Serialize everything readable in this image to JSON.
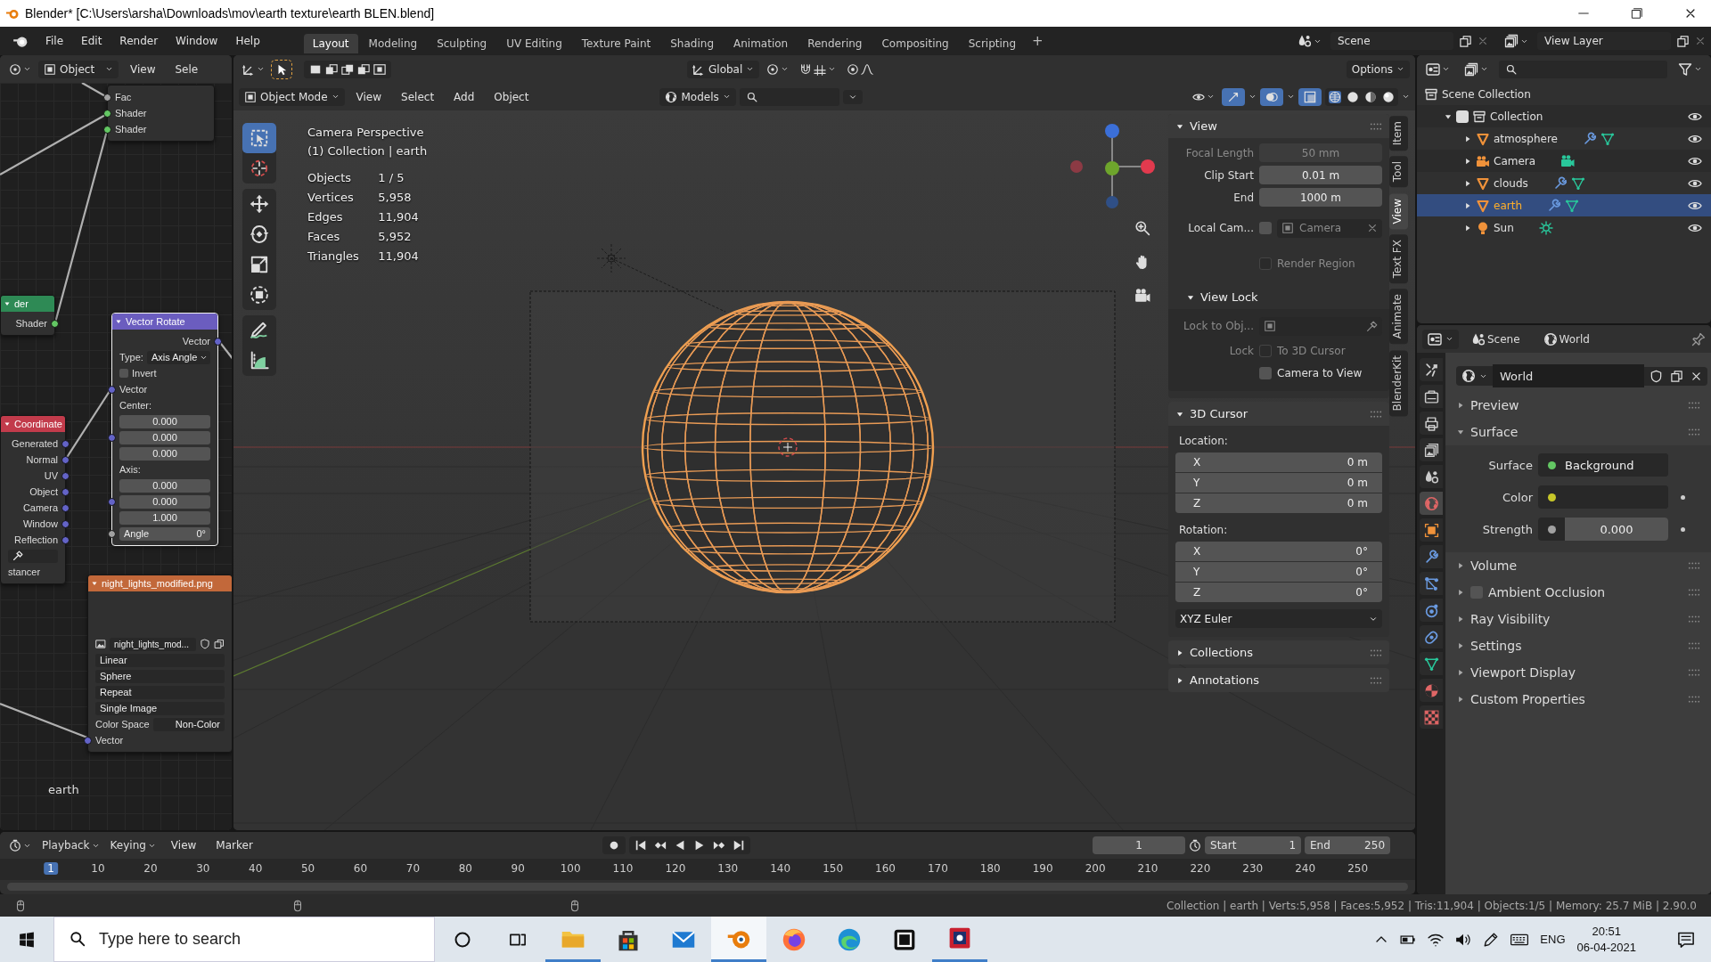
{
  "window": {
    "title": "Blender* [C:\\Users\\arsha\\Downloads\\mov\\earth texture\\earth BLEN.blend]"
  },
  "menu": [
    "File",
    "Edit",
    "Render",
    "Window",
    "Help"
  ],
  "workspaces": [
    {
      "label": "Layout",
      "selected": true
    },
    {
      "label": "Modeling",
      "selected": false
    },
    {
      "label": "Sculpting",
      "selected": false
    },
    {
      "label": "UV Editing",
      "selected": false
    },
    {
      "label": "Texture Paint",
      "selected": false
    },
    {
      "label": "Shading",
      "selected": false
    },
    {
      "label": "Animation",
      "selected": false
    },
    {
      "label": "Rendering",
      "selected": false
    },
    {
      "label": "Compositing",
      "selected": false
    },
    {
      "label": "Scripting",
      "selected": false
    }
  ],
  "add_workspace": "+",
  "scene": "Scene",
  "view_layer": "View Layer",
  "node_editor": {
    "mode": "Object",
    "menus": [
      "View",
      "Sele"
    ],
    "material_name": "earth",
    "nodes": [
      {
        "selected": false,
        "rows": [
          {
            "kind": "input",
            "label": "Fac",
            "color": "#a1a1a1"
          },
          {
            "kind": "input",
            "label": "Shader",
            "color": "#63c763"
          },
          {
            "kind": "input",
            "label": "Shader",
            "color": "#63c763"
          }
        ]
      },
      {
        "title": "der",
        "color": "#2e8a55",
        "selected": false,
        "rows": [
          {
            "kind": "output",
            "label": "Shader",
            "color": "#63c763"
          }
        ]
      },
      {
        "title": "Vector Rotate",
        "color": "#6b5dbf",
        "selected": true,
        "rows": [
          {
            "kind": "output",
            "label": "Vector",
            "color": "#6363c7"
          },
          {
            "kind": "dropdown",
            "label": "Type:",
            "value": "Axis Angle"
          },
          {
            "kind": "checkbox",
            "label": "Invert",
            "checked": false
          },
          {
            "kind": "input",
            "label": "Vector",
            "color": "#6363c7"
          },
          {
            "kind": "label",
            "label": "Center:"
          },
          {
            "kind": "number",
            "value": "0.000"
          },
          {
            "kind": "number",
            "value": "0.000",
            "color": "#6363c7"
          },
          {
            "kind": "number",
            "value": "0.000"
          },
          {
            "kind": "label",
            "label": "Axis:"
          },
          {
            "kind": "number",
            "value": "0.000"
          },
          {
            "kind": "number",
            "value": "0.000",
            "color": "#6363c7"
          },
          {
            "kind": "number",
            "value": "1.000"
          },
          {
            "kind": "number",
            "label": "Angle",
            "value": "0°",
            "color": "#a1a1a1"
          }
        ]
      },
      {
        "title": "Coordinate",
        "color": "#c23b4b",
        "selected": false,
        "rows": [
          {
            "kind": "output",
            "label": "Generated",
            "color": "#6363c7"
          },
          {
            "kind": "output",
            "label": "Normal",
            "color": "#6363c7"
          },
          {
            "kind": "output",
            "label": "UV",
            "color": "#6363c7"
          },
          {
            "kind": "output",
            "label": "Object",
            "color": "#6363c7"
          },
          {
            "kind": "output",
            "label": "Camera",
            "color": "#6363c7"
          },
          {
            "kind": "output",
            "label": "Window",
            "color": "#6363c7"
          },
          {
            "kind": "output",
            "label": "Reflection",
            "color": "#6363c7"
          },
          {
            "kind": "object_field"
          },
          {
            "kind": "label",
            "label": "stancer"
          }
        ]
      },
      {
        "title": "night_lights_modified.png",
        "color": "#c2683a",
        "selected": false,
        "rows": [
          {
            "kind": "preview"
          },
          {
            "kind": "image_select",
            "value": "night_lights_mod..."
          },
          {
            "kind": "select",
            "value": "Linear"
          },
          {
            "kind": "select",
            "value": "Sphere"
          },
          {
            "kind": "select",
            "value": "Repeat"
          },
          {
            "kind": "select",
            "value": "Single Image"
          },
          {
            "kind": "pair",
            "label": "Color Space",
            "value": "Non-Color"
          },
          {
            "kind": "input",
            "label": "Vector",
            "color": "#6363c7"
          }
        ]
      }
    ]
  },
  "viewport": {
    "orientation": "Global",
    "options": "Options",
    "mode": "Object Mode",
    "menus": [
      "View",
      "Select",
      "Add",
      "Object"
    ],
    "filter": "Models",
    "tools": [
      {
        "kind": "select_box",
        "selected": true
      },
      {
        "kind": "cursor",
        "selected": false
      },
      {
        "kind": "move",
        "selected": false
      },
      {
        "kind": "rotate",
        "selected": false
      },
      {
        "kind": "scale",
        "selected": false
      },
      {
        "kind": "transform",
        "selected": false
      },
      {
        "kind": "annotate",
        "selected": false
      },
      {
        "kind": "measure",
        "selected": false
      }
    ],
    "view_name": "Camera Perspective",
    "context": "(1) Collection | earth",
    "stats": [
      {
        "label": "Objects",
        "value": "1 / 5"
      },
      {
        "label": "Vertices",
        "value": "5,958"
      },
      {
        "label": "Edges",
        "value": "11,904"
      },
      {
        "label": "Faces",
        "value": "5,952"
      },
      {
        "label": "Triangles",
        "value": "11,904"
      }
    ]
  },
  "sidebar": {
    "tabs": [
      {
        "label": "Item",
        "selected": false
      },
      {
        "label": "Tool",
        "selected": false
      },
      {
        "label": "View",
        "selected": true
      },
      {
        "label": "Text FX",
        "selected": false
      },
      {
        "label": "Animate",
        "selected": false
      },
      {
        "label": "BlenderKit",
        "selected": false
      }
    ],
    "panels": [
      {
        "title": "View",
        "expanded": true,
        "rows": [
          {
            "kind": "field",
            "label": "Focal Length",
            "value": "50 mm",
            "disabled": true
          },
          {
            "kind": "field",
            "label": "Clip Start",
            "value": "0.01 m",
            "disabled": false
          },
          {
            "kind": "field",
            "label": "End",
            "value": "1000 m",
            "disabled": false
          },
          {
            "kind": "camera",
            "label": "Local Cam...",
            "checked": false,
            "value": "Camera"
          },
          {
            "kind": "checkbox",
            "label": "Render Region",
            "checked": false,
            "disabled": true
          },
          {
            "kind": "subpanel",
            "title": "View Lock",
            "expanded": true,
            "rows": [
              {
                "kind": "lock",
                "label": "Lock to Obj...",
                "disabled": true
              },
              {
                "kind": "checkbox",
                "prefix": "Lock",
                "label": "To 3D Cursor",
                "checked": false,
                "disabled": true
              },
              {
                "kind": "checkbox",
                "label": "Camera to View",
                "checked": false,
                "disabled": false
              }
            ]
          }
        ]
      },
      {
        "title": "3D Cursor",
        "expanded": true,
        "rows": [
          {
            "kind": "heading",
            "label": "Location:"
          },
          {
            "kind": "vector",
            "values": [
              {
                "axis": "X",
                "value": "0 m"
              },
              {
                "axis": "Y",
                "value": "0 m"
              },
              {
                "axis": "Z",
                "value": "0 m"
              }
            ]
          },
          {
            "kind": "heading",
            "label": "Rotation:"
          },
          {
            "kind": "vector",
            "values": [
              {
                "axis": "X",
                "value": "0°"
              },
              {
                "axis": "Y",
                "value": "0°"
              },
              {
                "axis": "Z",
                "value": "0°"
              }
            ]
          },
          {
            "kind": "dropdown",
            "value": "XYZ Euler"
          }
        ]
      },
      {
        "title": "Collections",
        "expanded": false
      },
      {
        "title": "Annotations",
        "expanded": false
      }
    ]
  },
  "outliner": {
    "tree": [
      {
        "name": "Scene Collection",
        "kind": "scene_collection",
        "selected": false,
        "children": [
          {
            "name": "Collection",
            "kind": "collection",
            "selected": false,
            "expanded": true,
            "checked": true,
            "children": [
              {
                "name": "atmosphere",
                "kind": "mesh",
                "selected": false,
                "expanded": false,
                "modifiers": true
              },
              {
                "name": "Camera",
                "kind": "camera",
                "selected": false,
                "expanded": false,
                "modifiers": false
              },
              {
                "name": "clouds",
                "kind": "mesh",
                "selected": false,
                "expanded": false,
                "modifiers": true
              },
              {
                "name": "earth",
                "kind": "mesh",
                "selected": true,
                "expanded": false,
                "modifiers": true
              },
              {
                "name": "Sun",
                "kind": "light",
                "selected": false,
                "expanded": false,
                "modifiers": false
              }
            ]
          }
        ]
      }
    ]
  },
  "properties": {
    "context": [
      "Scene",
      "World"
    ],
    "world": "World",
    "tabs": [
      {
        "kind": "tool",
        "selected": false
      },
      {
        "kind": "render",
        "selected": false
      },
      {
        "kind": "output",
        "selected": false
      },
      {
        "kind": "view_layer",
        "selected": false
      },
      {
        "kind": "scene",
        "selected": false
      },
      {
        "kind": "world",
        "selected": true
      },
      {
        "kind": "object",
        "selected": false
      },
      {
        "kind": "modifiers",
        "selected": false
      },
      {
        "kind": "particles",
        "selected": false
      },
      {
        "kind": "physics",
        "selected": false
      },
      {
        "kind": "constraints",
        "selected": false
      },
      {
        "kind": "data",
        "selected": false
      },
      {
        "kind": "material",
        "selected": false
      },
      {
        "kind": "texture",
        "selected": false
      }
    ],
    "panels": [
      {
        "label": "Preview",
        "kind": "panel",
        "expanded": false
      },
      {
        "label": "Surface",
        "kind": "panel",
        "expanded": true,
        "rows": [
          {
            "kind": "link",
            "label": "Surface",
            "value": "Background"
          },
          {
            "kind": "color",
            "label": "Color"
          },
          {
            "kind": "number",
            "label": "Strength",
            "value": "0.000"
          }
        ]
      },
      {
        "label": "Volume",
        "kind": "panel",
        "expanded": false
      },
      {
        "label": "Ambient Occlusion",
        "kind": "toggle",
        "checked": false,
        "expanded": false
      },
      {
        "label": "Ray Visibility",
        "kind": "panel",
        "expanded": false
      },
      {
        "label": "Settings",
        "kind": "panel",
        "expanded": false
      },
      {
        "label": "Viewport Display",
        "kind": "panel",
        "expanded": false
      },
      {
        "label": "Custom Properties",
        "kind": "panel",
        "expanded": false
      }
    ]
  },
  "timeline": {
    "menus": [
      {
        "label": "Playback",
        "kind": "dropdown"
      },
      {
        "label": "Keying",
        "kind": "dropdown"
      },
      {
        "label": "View",
        "kind": "menu"
      },
      {
        "label": "Marker",
        "kind": "menu"
      }
    ],
    "current_frame": "1",
    "start_label": "Start",
    "start": "1",
    "end_label": "End",
    "end": "250",
    "ruler": [
      {
        "label": "1",
        "selected": true
      },
      {
        "label": "10",
        "selected": false
      },
      {
        "label": "20",
        "selected": false
      },
      {
        "label": "30",
        "selected": false
      },
      {
        "label": "40",
        "selected": false
      },
      {
        "label": "50",
        "selected": false
      },
      {
        "label": "60",
        "selected": false
      },
      {
        "label": "70",
        "selected": false
      },
      {
        "label": "80",
        "selected": false
      },
      {
        "label": "90",
        "selected": false
      },
      {
        "label": "100",
        "selected": false
      },
      {
        "label": "110",
        "selected": false
      },
      {
        "label": "120",
        "selected": false
      },
      {
        "label": "130",
        "selected": false
      },
      {
        "label": "140",
        "selected": false
      },
      {
        "label": "150",
        "selected": false
      },
      {
        "label": "160",
        "selected": false
      },
      {
        "label": "170",
        "selected": false
      },
      {
        "label": "180",
        "selected": false
      },
      {
        "label": "190",
        "selected": false
      },
      {
        "label": "200",
        "selected": false
      },
      {
        "label": "210",
        "selected": false
      },
      {
        "label": "220",
        "selected": false
      },
      {
        "label": "230",
        "selected": false
      },
      {
        "label": "240",
        "selected": false
      },
      {
        "label": "250",
        "selected": false
      }
    ]
  },
  "status_bar": "Collection | earth | Verts:5,958 | Faces:5,952 | Tris:11,904 | Objects:1/5 | Memory: 25.7 MiB | 2.90.0",
  "taskbar": {
    "search": {
      "placeholder": "Type here to search"
    },
    "apps": [
      {
        "kind": "explorer",
        "running": true,
        "selected": false
      },
      {
        "kind": "store",
        "running": false,
        "selected": false
      },
      {
        "kind": "mail",
        "running": false,
        "selected": false
      },
      {
        "kind": "blender",
        "running": true,
        "selected": true
      },
      {
        "kind": "firefox",
        "running": false,
        "selected": false
      },
      {
        "kind": "edge",
        "running": false,
        "selected": false
      },
      {
        "kind": "notion",
        "running": false,
        "selected": false
      },
      {
        "kind": "capture",
        "running": true,
        "selected": false
      }
    ],
    "tray": {
      "language": "ENG",
      "time": "20:51",
      "date": "06-04-2021"
    }
  }
}
